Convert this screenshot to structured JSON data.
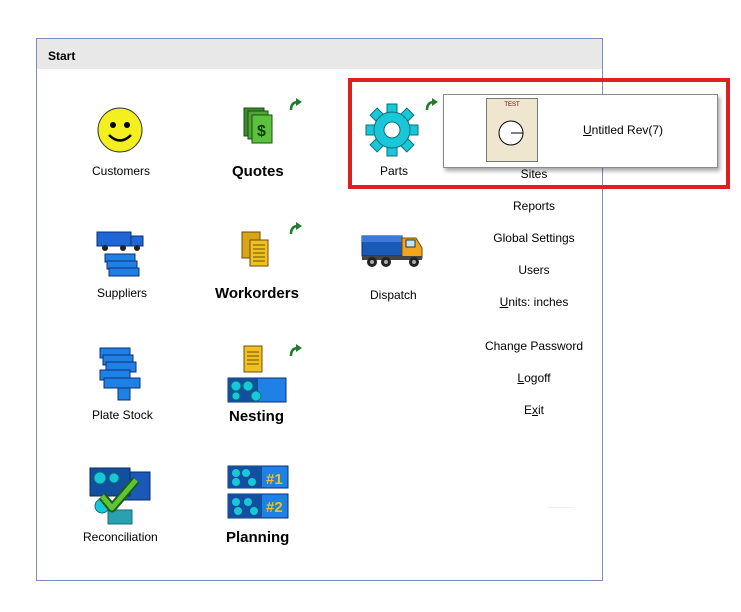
{
  "panel": {
    "title": "Start"
  },
  "tiles": {
    "customers": "Customers",
    "quotes": "Quotes",
    "parts": "Parts",
    "suppliers": "Suppliers",
    "workorders": "Workorders",
    "dispatch": "Dispatch",
    "plate_stock": "Plate Stock",
    "nesting": "Nesting",
    "reconciliation": "Reconciliation",
    "planning": "Planning"
  },
  "links": {
    "sites": "Sites",
    "reports": "Reports",
    "global_settings": "Global Settings",
    "users": "Users",
    "units_mnemonic": "U",
    "units_rest": "nits: inches",
    "change_password": "Change Password",
    "logoff_mnemonic": "L",
    "logoff_rest": "ogoff",
    "exit_pre": "E",
    "exit_mnemonic": "x",
    "exit_post": "it"
  },
  "popup": {
    "thumb_label": "TEST",
    "item_mnemonic": "U",
    "item_rest": "ntitled Rev(7)"
  },
  "icons": {
    "customers": "smiley-icon",
    "quotes": "money-stack-icon",
    "parts": "gear-icon",
    "suppliers": "truck-icon",
    "workorders": "documents-icon",
    "dispatch": "dispatch-truck-icon",
    "plate_stock": "plate-stack-icon",
    "nesting": "nesting-icon",
    "reconciliation": "checkmark-icon",
    "planning": "planning-icon"
  },
  "colors": {
    "highlight": "#e0201f",
    "header": "#e8e8e8",
    "panel_border": "#7a8fb8"
  }
}
